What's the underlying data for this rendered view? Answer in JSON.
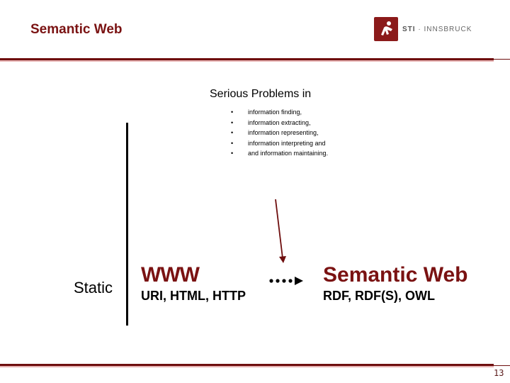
{
  "header": {
    "title": "Semantic Web",
    "logo": {
      "icon": "sti-runner-logo-icon",
      "brand": "STI",
      "separator": "·",
      "name": "INNSBRUCK"
    }
  },
  "content": {
    "problems_title": "Serious Problems in",
    "bullet_glyph": "•",
    "problems": [
      "information finding,",
      "information extracting,",
      "information representing,",
      "information interpreting and",
      "and information maintaining."
    ],
    "static_label": "Static",
    "www": {
      "title": "WWW",
      "subtitle": "URI, HTML, HTTP"
    },
    "semantic_web": {
      "title": "Semantic Web",
      "subtitle": "RDF, RDF(S), OWL"
    },
    "transition_arrow": "dotted-arrow-right-icon",
    "problem_arrow": "arrow-down-icon"
  },
  "footer": {
    "page_number": "13"
  },
  "colors": {
    "brand": "#7a1212",
    "rule": "#6e0e0e",
    "rule_shadow": "#e8b4b4"
  }
}
